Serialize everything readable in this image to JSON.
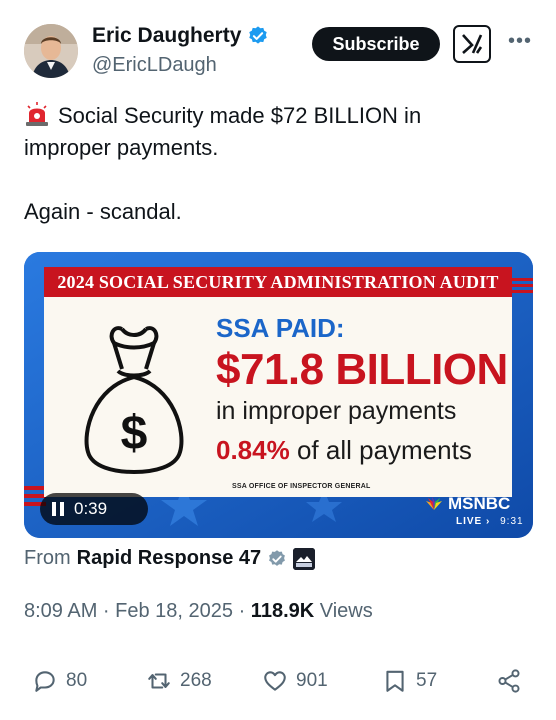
{
  "author": {
    "name": "Eric Daugherty",
    "handle": "@EricLDaugh"
  },
  "header": {
    "subscribe_label": "Subscribe"
  },
  "tweet": {
    "line1": "Social Security made $72 BILLION in",
    "line2": "improper payments.",
    "line3": "Again - scandal."
  },
  "media": {
    "banner": "2024 SOCIAL SECURITY ADMINISTRATION AUDIT",
    "headline": "SSA PAID:",
    "amount": "$71.8 BILLION",
    "subline": "in improper payments",
    "percent": "0.84%",
    "percent_rest": "of all payments",
    "source": "SSA OFFICE OF INSPECTOR GENERAL",
    "duration": "0:39",
    "network": "MSNBC",
    "live": "LIVE",
    "live_time": "9:31"
  },
  "source": {
    "prefix": "From",
    "name": "Rapid Response 47"
  },
  "meta": {
    "time": "8:09 AM · Feb 18, 2025 · ",
    "views": "118.9K",
    "views_label": " Views"
  },
  "actions": {
    "replies": "80",
    "reposts": "268",
    "likes": "901",
    "bookmarks": "57"
  },
  "colors": {
    "accent": "#1d9bf0",
    "banner_red": "#c8141f",
    "ssa_blue": "#1b66c9"
  }
}
